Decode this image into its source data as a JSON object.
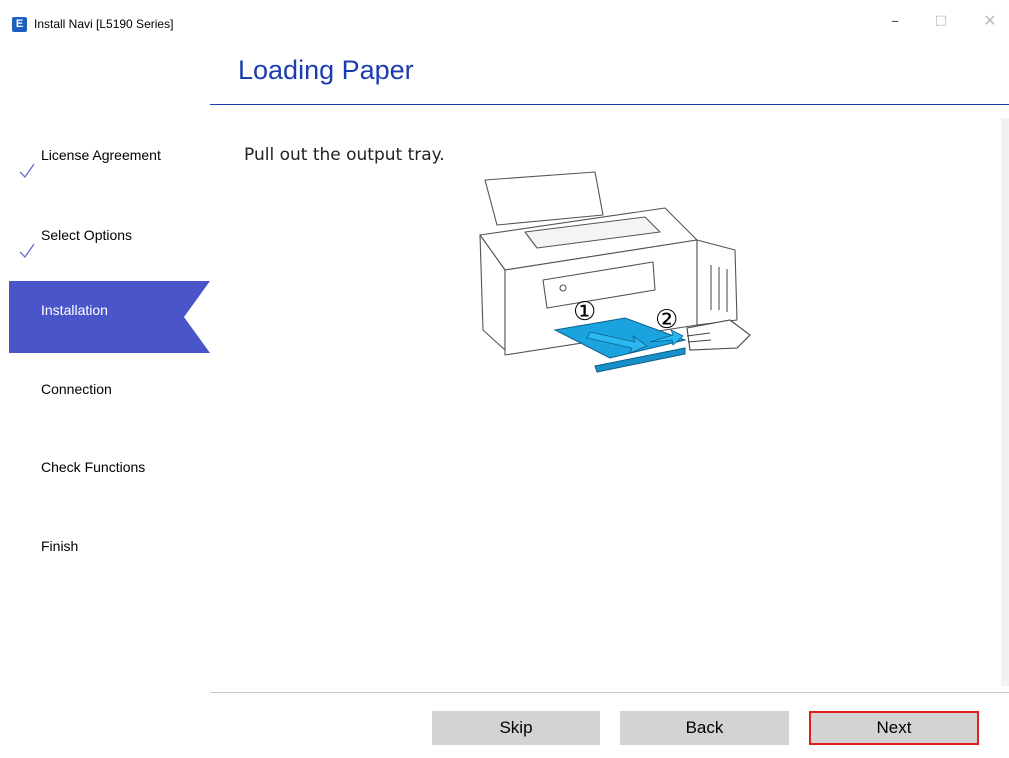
{
  "window": {
    "icon_letter": "E",
    "title": "Install Navi [L5190 Series]",
    "minimize_glyph": "–",
    "maximize_glyph": "□",
    "close_glyph": "✕"
  },
  "page": {
    "title": "Loading Paper",
    "instruction": "Pull out the output tray.",
    "callout_1": "①",
    "callout_2": "②"
  },
  "sidebar": {
    "items": [
      {
        "label": "License Agreement",
        "state": "done"
      },
      {
        "label": "Select Options",
        "state": "done"
      },
      {
        "label": "Installation",
        "state": "active"
      },
      {
        "label": "Connection",
        "state": "pending"
      },
      {
        "label": "Check Functions",
        "state": "pending"
      },
      {
        "label": "Finish",
        "state": "pending"
      }
    ]
  },
  "footer": {
    "skip_label": "Skip",
    "back_label": "Back",
    "next_label": "Next"
  },
  "colors": {
    "accent": "#1c3cb0",
    "active_step": "#4a55c9",
    "tray": "#1ba3e0",
    "next_highlight": "#e02020"
  }
}
